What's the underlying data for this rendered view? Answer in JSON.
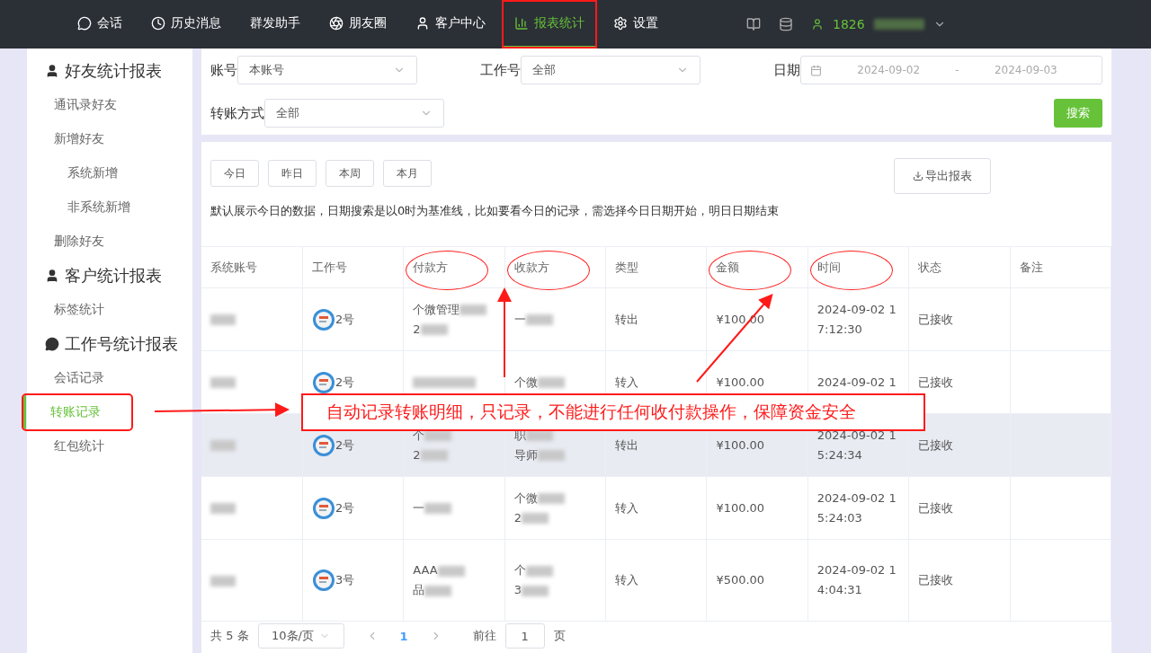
{
  "nav": {
    "items": [
      {
        "label": "会话",
        "selected": false,
        "annotated": false
      },
      {
        "label": "历史消息",
        "selected": false,
        "annotated": false
      },
      {
        "label": "群发助手",
        "selected": false,
        "annotated": false
      },
      {
        "label": "朋友圈",
        "selected": false,
        "annotated": false
      },
      {
        "label": "客户中心",
        "selected": false,
        "annotated": false
      },
      {
        "label": "报表统计",
        "selected": true,
        "annotated": true
      },
      {
        "label": "设置",
        "selected": false,
        "annotated": false
      }
    ],
    "user": {
      "phone": "1826"
    }
  },
  "sidebar": {
    "sections": [
      {
        "title": "好友统计报表",
        "items": [
          {
            "label": "通讯录好友",
            "selected": false,
            "annotated": false
          },
          {
            "label": "新增好友",
            "selected": false,
            "annotated": false,
            "children": [
              {
                "label": "系统新增",
                "selected": false,
                "annotated": false
              },
              {
                "label": "非系统新增",
                "selected": false,
                "annotated": false
              }
            ]
          },
          {
            "label": "删除好友",
            "selected": false,
            "annotated": false
          }
        ]
      },
      {
        "title": "客户统计报表",
        "items": [
          {
            "label": "标签统计",
            "selected": false,
            "annotated": false
          }
        ]
      },
      {
        "title": "工作号统计报表",
        "items": [
          {
            "label": "会话记录",
            "selected": false,
            "annotated": false
          },
          {
            "label": "转账记录",
            "selected": true,
            "annotated": true
          },
          {
            "label": "红包统计",
            "selected": false,
            "annotated": false
          }
        ]
      }
    ]
  },
  "filters": {
    "account": {
      "label": "账号",
      "value": "本账号"
    },
    "work_no": {
      "label": "工作号",
      "value": "全部"
    },
    "date": {
      "label": "日期",
      "start": "2024-09-02",
      "separator": "-",
      "end": "2024-09-03"
    },
    "method": {
      "label": "转账方式",
      "value": "全部"
    },
    "search_button": "搜索"
  },
  "quick_buttons": [
    "今日",
    "昨日",
    "本周",
    "本月"
  ],
  "export_button": "导出报表",
  "note": "默认展示今日的数据，日期搜索是以0时为基准线，比如要看今日的记录，需选择今日日期开始，明日日期结束",
  "table": {
    "columns": [
      {
        "label": "系统账号",
        "circled": false
      },
      {
        "label": "工作号",
        "circled": false
      },
      {
        "label": "付款方",
        "circled": true
      },
      {
        "label": "收款方",
        "circled": true
      },
      {
        "label": "类型",
        "circled": false
      },
      {
        "label": "金额",
        "circled": true
      },
      {
        "label": "时间",
        "circled": true
      },
      {
        "label": "状态",
        "circled": false
      },
      {
        "label": "备注",
        "circled": false
      }
    ],
    "rows": [
      {
        "work_no": "2号",
        "payer": [
          "个微管理",
          "2"
        ],
        "payee": [
          "一"
        ],
        "type": "转出",
        "amount": "¥100.00",
        "time": "2024-09-02 17:12:30",
        "status": "已接收",
        "highlighted": false
      },
      {
        "work_no": "2号",
        "payee": [
          "个微"
        ],
        "type": "转入",
        "amount": "¥100.00",
        "time": "2024-09-02 1",
        "status": "已接收",
        "highlighted": false
      },
      {
        "work_no": "2号",
        "payer": [
          "个",
          "2"
        ],
        "payee": [
          "职",
          "导师"
        ],
        "type": "转出",
        "amount": "¥100.00",
        "time": "2024-09-02 15:24:34",
        "status": "已接收",
        "highlighted": true
      },
      {
        "work_no": "2号",
        "payer": [
          "一"
        ],
        "payee": [
          "个微",
          "2"
        ],
        "type": "转入",
        "amount": "¥100.00",
        "time": "2024-09-02 15:24:03",
        "status": "已接收",
        "highlighted": false
      },
      {
        "work_no": "3号",
        "payer": [
          "AAA",
          "品"
        ],
        "payee": [
          "个",
          "3"
        ],
        "type": "转入",
        "amount": "¥500.00",
        "time": "2024-09-02 14:04:31",
        "status": "已接收",
        "highlighted": false
      }
    ]
  },
  "pagination": {
    "total": "共 5 条",
    "page_size": "10条/页",
    "pages": [
      {
        "label": "1",
        "selected": true
      }
    ],
    "goto": "前往",
    "goto_value": "1",
    "page_unit": "页"
  },
  "callout": "自动记录转账明细，只记录，不能进行任何收付款操作，保障资金安全"
}
